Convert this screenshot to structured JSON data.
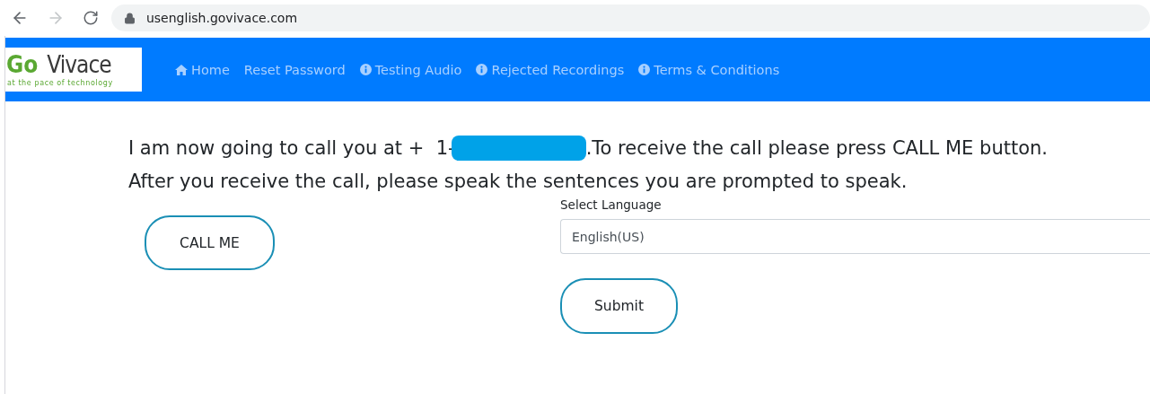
{
  "browser": {
    "url": "usenglish.govivace.com",
    "forward_disabled": true
  },
  "logo": {
    "part_1": "Go",
    "part_2": "Vivace",
    "tagline": "at the pace of technology"
  },
  "nav": [
    {
      "label": "Home",
      "kind": "home"
    },
    {
      "label": "Reset Password",
      "kind": "plain"
    },
    {
      "label": "Testing Audio",
      "kind": "info"
    },
    {
      "label": "Rejected Recordings",
      "kind": "info"
    },
    {
      "label": "Terms & Conditions",
      "kind": "info"
    }
  ],
  "message": {
    "line_1_start": "I am now going to call you at +  1-",
    "redacted": true,
    "line_1_end": ".To receive the call please press CALL ME button.",
    "line_2": "After you receive the call, please speak the sentences you are prompted to speak."
  },
  "call_button": "CALL ME",
  "language": {
    "label": "Select Language",
    "value": "English(US)"
  },
  "submit_button": "Submit"
}
